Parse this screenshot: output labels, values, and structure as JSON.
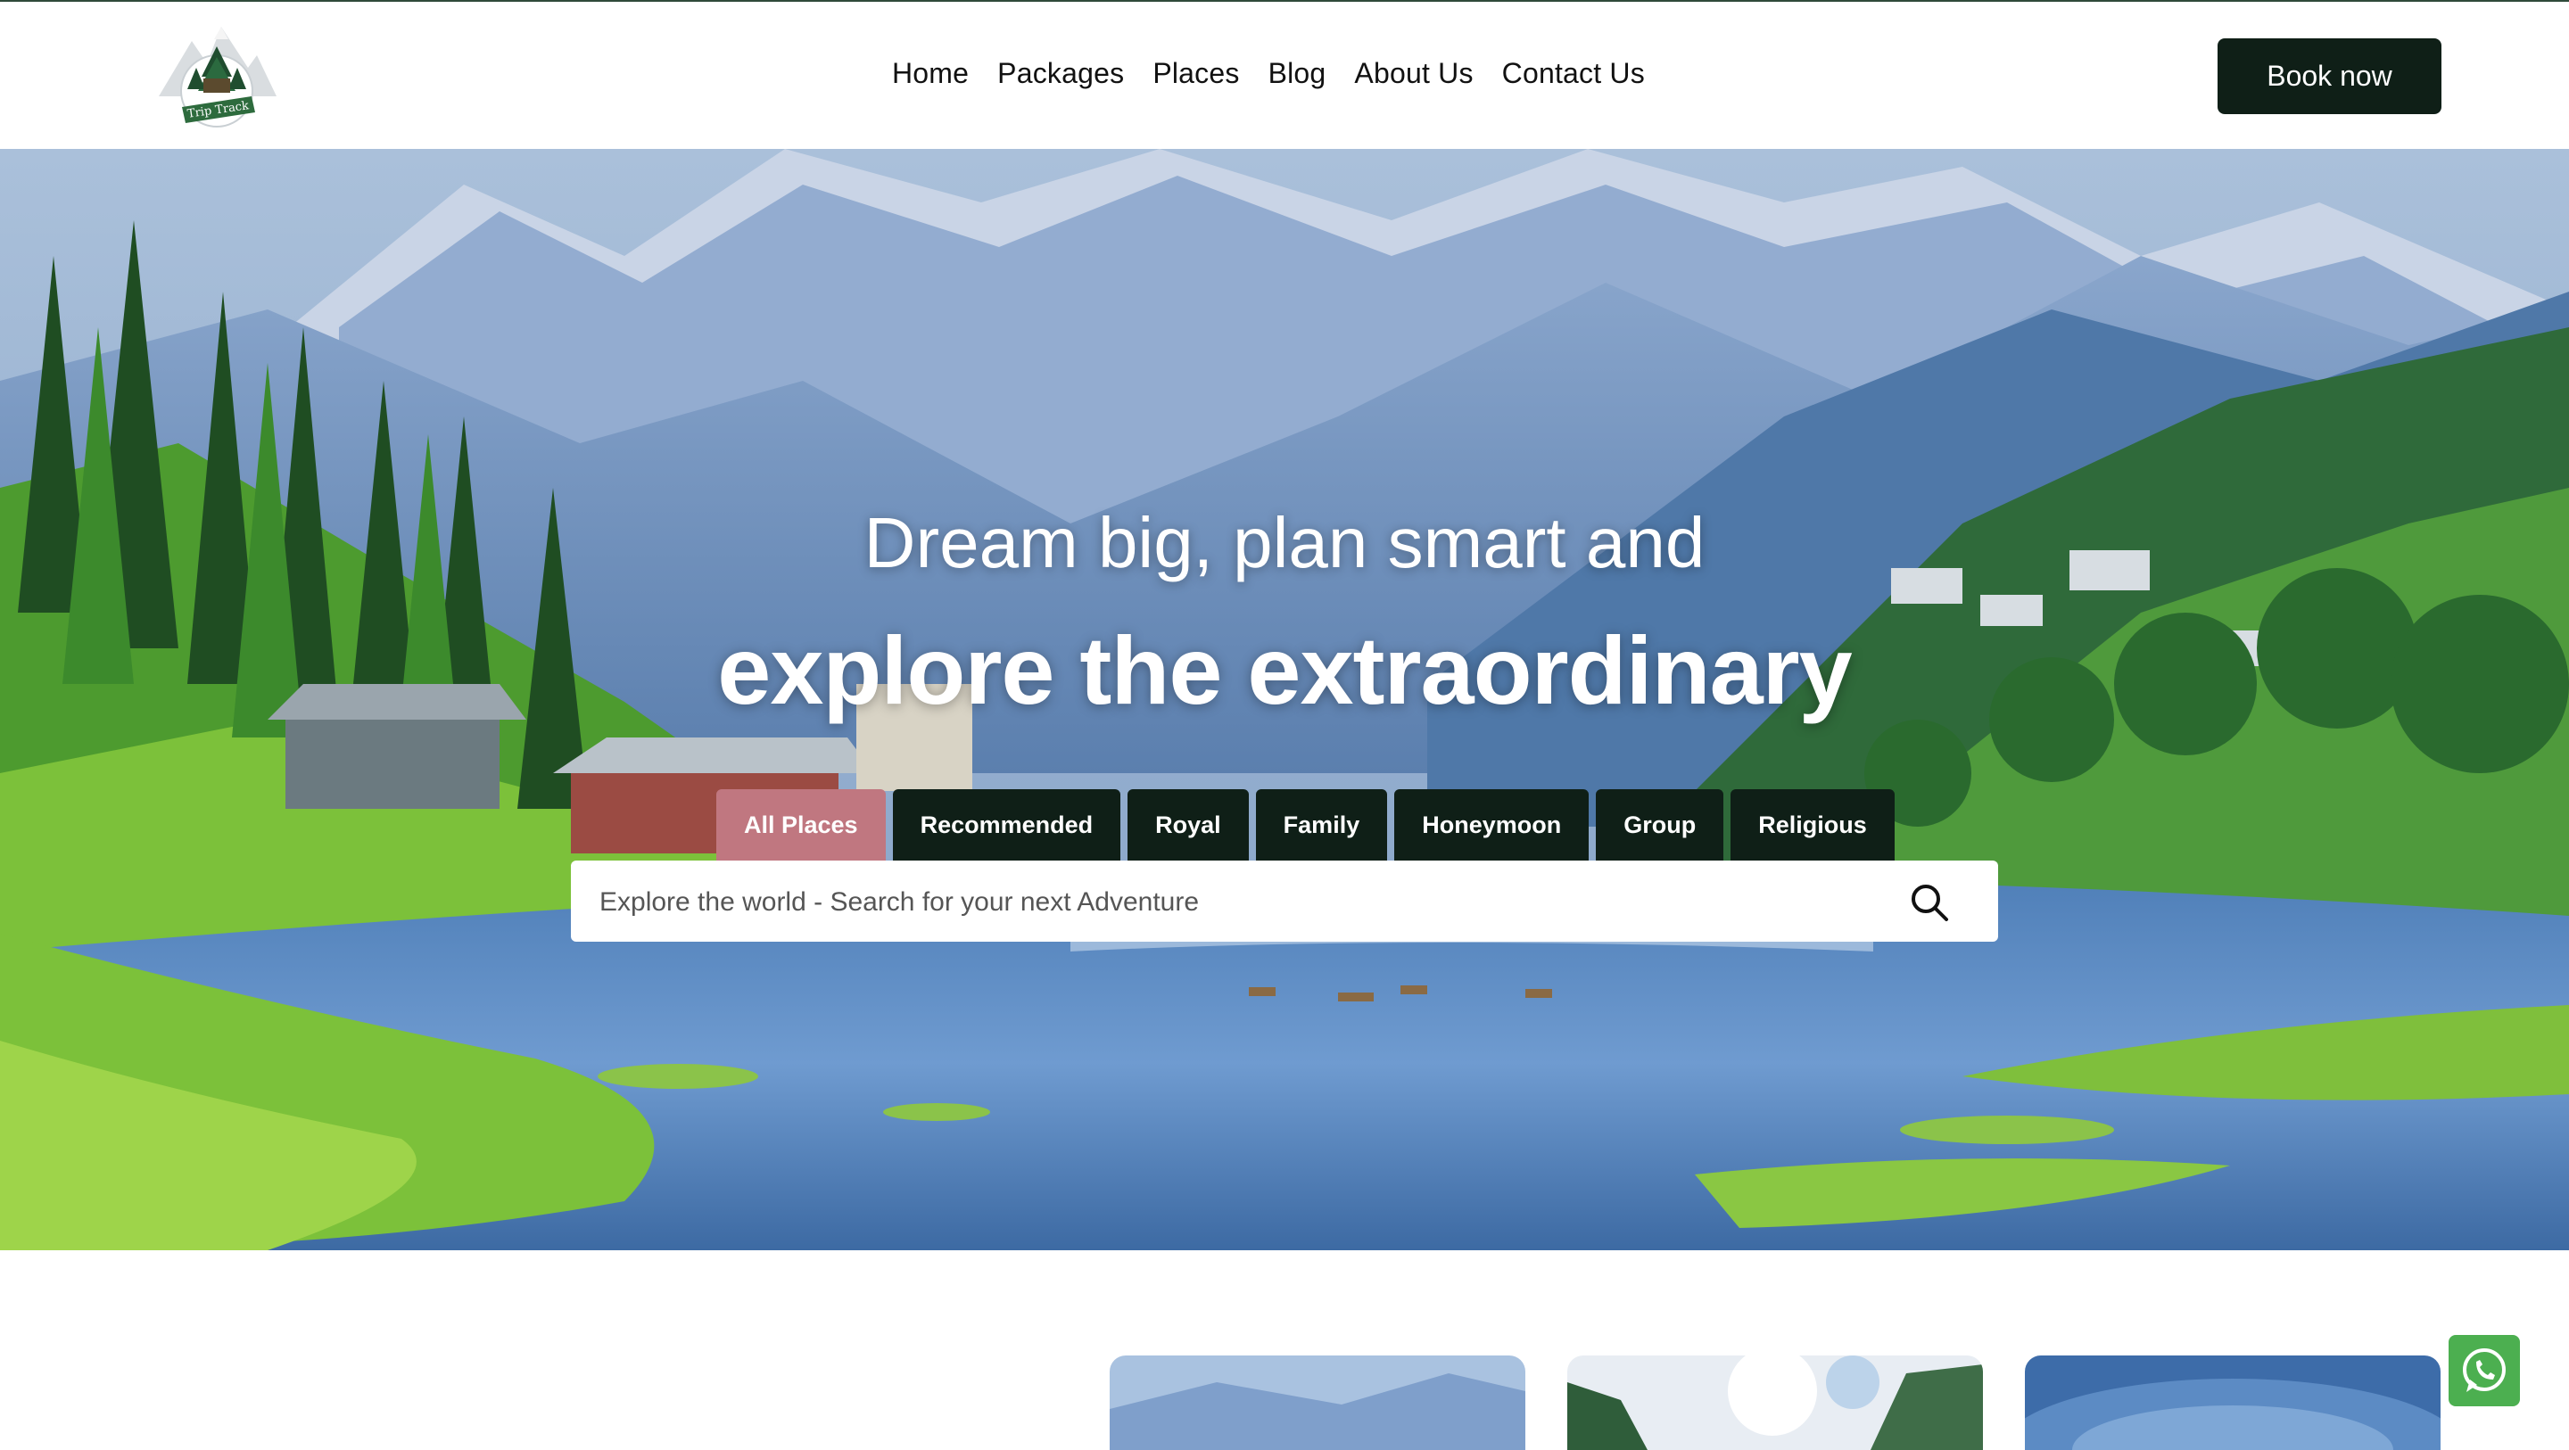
{
  "brand": {
    "logo_text": "Trip Track"
  },
  "nav": {
    "items": [
      {
        "label": "Home"
      },
      {
        "label": "Packages"
      },
      {
        "label": "Places"
      },
      {
        "label": "Blog"
      },
      {
        "label": "About Us"
      },
      {
        "label": "Contact Us"
      }
    ]
  },
  "header": {
    "book_label": "Book now"
  },
  "hero": {
    "title_line1": "Dream big, plan smart and",
    "title_line2": "explore the extraordinary",
    "tabs": [
      {
        "label": "All Places",
        "active": true
      },
      {
        "label": "Recommended",
        "active": false
      },
      {
        "label": "Royal",
        "active": false
      },
      {
        "label": "Family",
        "active": false
      },
      {
        "label": "Honeymoon",
        "active": false
      },
      {
        "label": "Group",
        "active": false
      },
      {
        "label": "Religious",
        "active": false
      }
    ],
    "search": {
      "placeholder": "Explore the world - Search for your next Adventure",
      "value": ""
    }
  },
  "colors": {
    "dark_green": "#0f1f17",
    "active_tab": "#c07780",
    "whatsapp_green": "#4caf50"
  },
  "icons": {
    "search": "search-icon",
    "whatsapp": "whatsapp-icon"
  }
}
